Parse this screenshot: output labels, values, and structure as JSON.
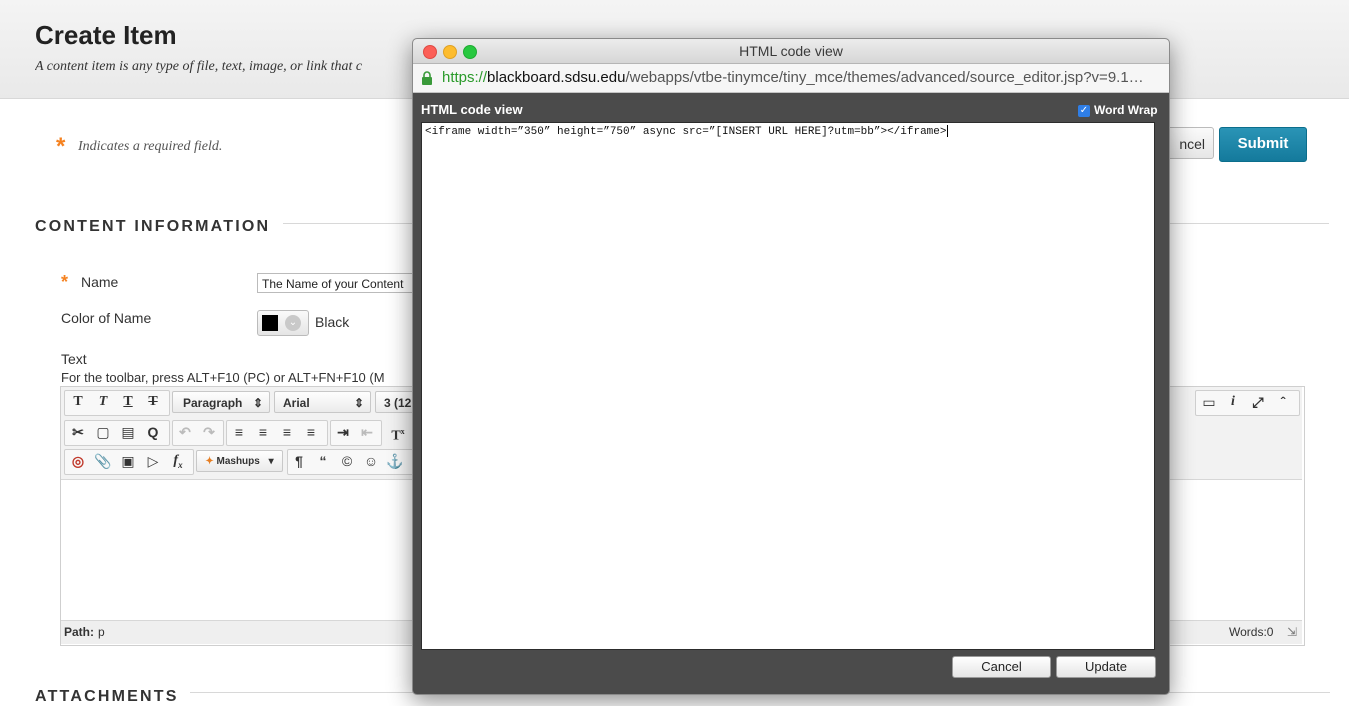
{
  "page": {
    "title": "Create Item",
    "description": "A content item is any type of file, text, image, or link that c",
    "required_note": "Indicates a required field.",
    "required_star": "*",
    "cancel_label": "ncel",
    "submit_label": "Submit"
  },
  "content_info": {
    "heading": "CONTENT INFORMATION",
    "name_label": "Name",
    "name_value": "The Name of your Content",
    "color_label": "Color of Name",
    "color_value": "Black",
    "text_label": "Text",
    "toolbar_hint": "For the toolbar, press ALT+F10 (PC) or ALT+FN+F10 (M"
  },
  "editor": {
    "format_select": "Paragraph",
    "font_select": "Arial",
    "size_select": "3 (12",
    "mashups_label": "Mashups",
    "path_label": "Path:",
    "path_value": "p",
    "words_label": "Words:0"
  },
  "attachments": {
    "heading": "ATTACHMENTS"
  },
  "dialog": {
    "window_title": "HTML code view",
    "url_scheme": "https://",
    "url_domain": "blackboard.sdsu.edu",
    "url_path": "/webapps/vtbe-tinymce/tiny_mce/themes/advanced/source_editor.jsp?v=9.1…",
    "panel_title": "HTML code view",
    "word_wrap_label": "Word Wrap",
    "code": "<iframe width=”350” height=”750” async src=”[INSERT URL HERE]?utm=bb”></iframe>",
    "cancel_label": "Cancel",
    "update_label": "Update"
  },
  "colors": {
    "accent_orange": "#f58220",
    "submit_blue": "#147a9c",
    "dialog_bg": "#4b4b4b"
  }
}
